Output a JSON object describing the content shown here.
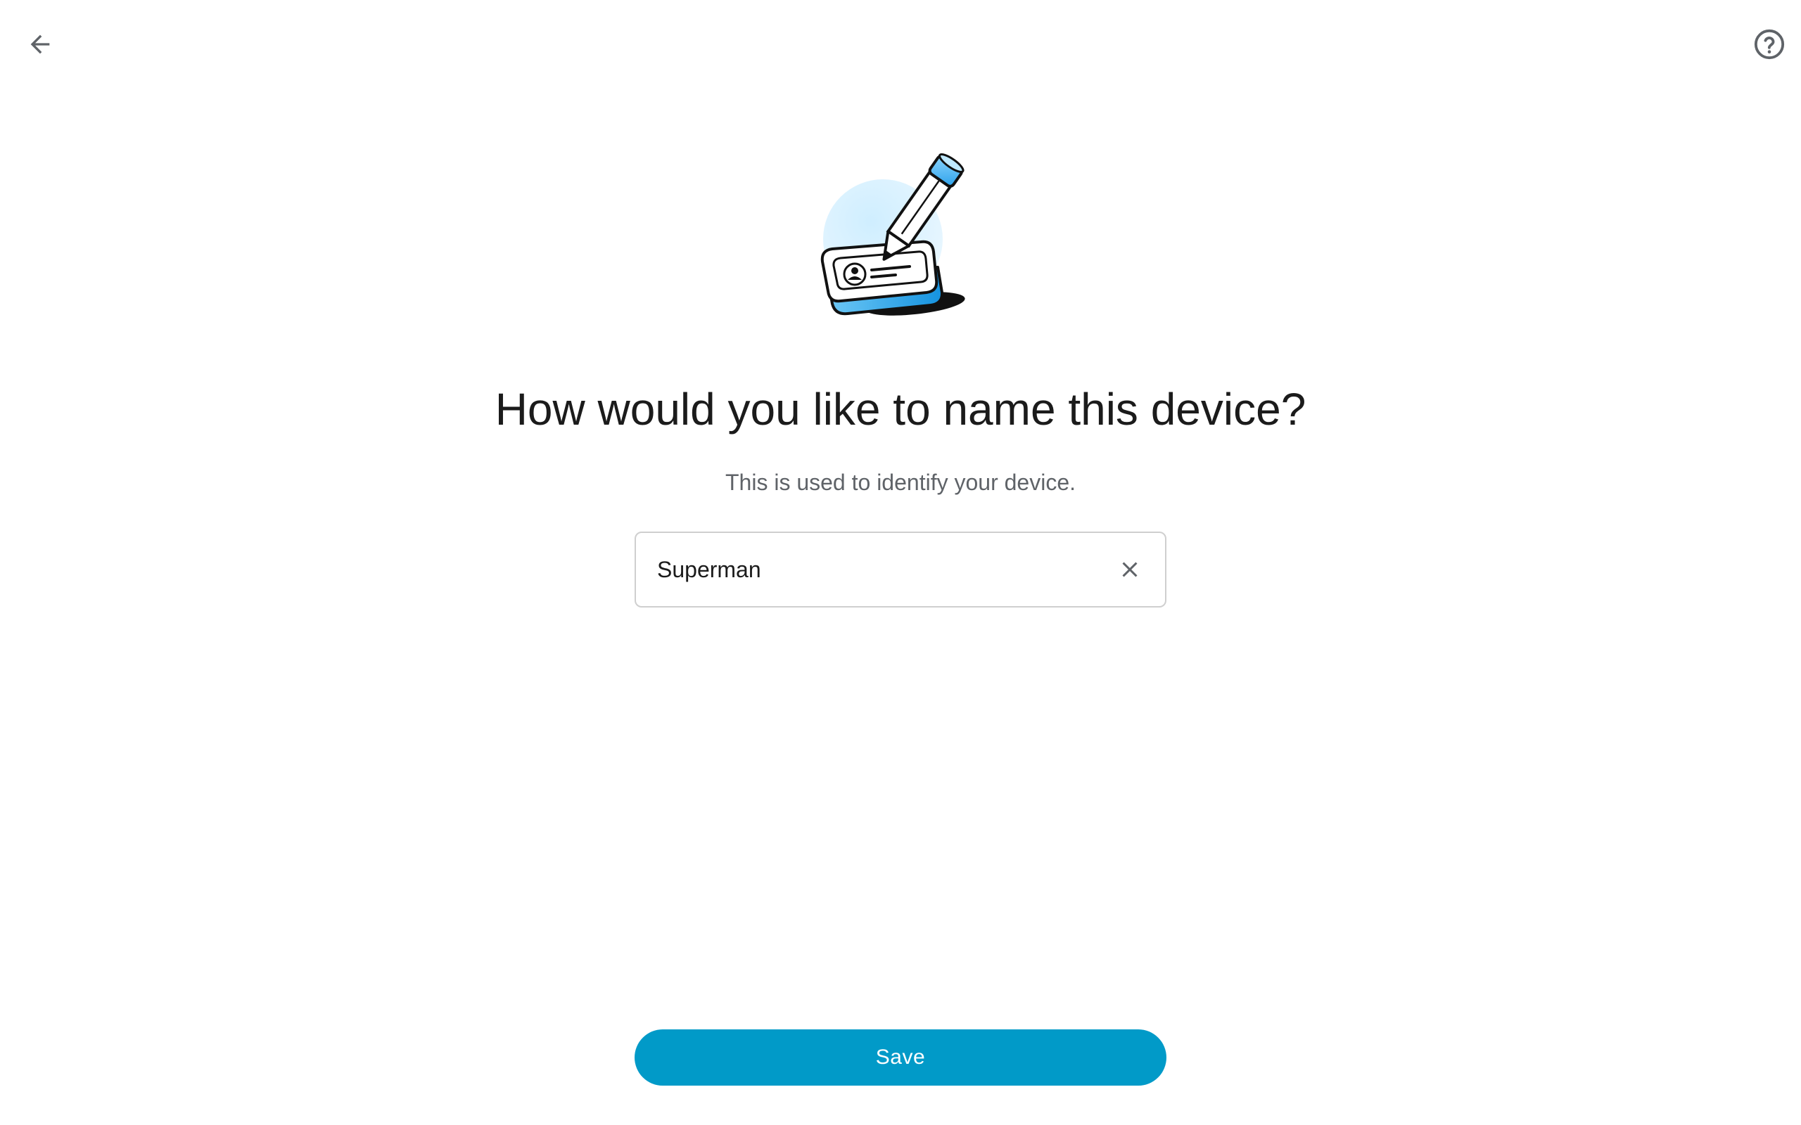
{
  "header": {
    "back_icon": "arrow-left-icon",
    "help_icon": "help-circle-icon"
  },
  "illustration": {
    "icon": "pencil-id-card-illustration"
  },
  "main": {
    "title": "How would you like to name this device?",
    "subtitle": "This is used to identify your device."
  },
  "name_field": {
    "value": "Superman",
    "clear_icon": "close-icon"
  },
  "footer": {
    "save_label": "Save"
  },
  "colors": {
    "accent": "#019ac8",
    "background": "#ffffff",
    "title_text": "#1b1b1b",
    "subtitle_text": "#5f6368",
    "input_border": "#cfcfcf",
    "icon_gray": "#5f6368"
  }
}
